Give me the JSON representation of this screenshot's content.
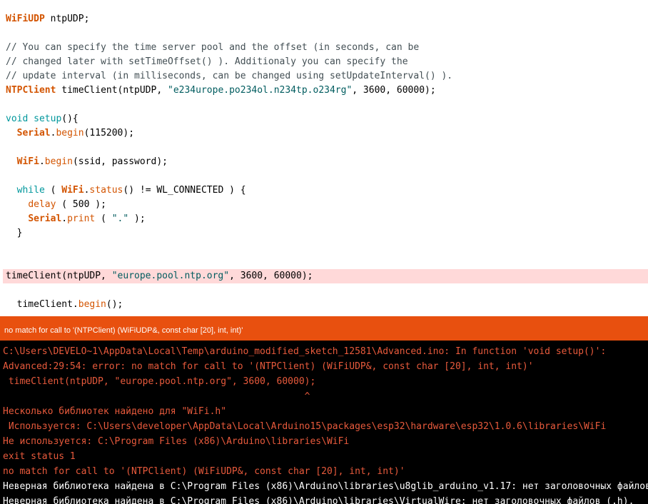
{
  "editor": {
    "lines": [
      [
        {
          "t": "WiFiUDP",
          "c": "type"
        },
        {
          "t": " ntpUDP;"
        }
      ],
      [],
      [
        {
          "t": "// You can specify the time server pool and the offset (in seconds, can be",
          "c": "cm"
        }
      ],
      [
        {
          "t": "// changed later with setTimeOffset() ). Additionaly you can specify the",
          "c": "cm"
        }
      ],
      [
        {
          "t": "// update interval (in milliseconds, can be changed using setUpdateInterval() ).",
          "c": "cm"
        }
      ],
      [
        {
          "t": "NTPClient",
          "c": "type"
        },
        {
          "t": " timeClient(ntpUDP, "
        },
        {
          "t": "\"e234urope.po234ol.n234tp.o234rg\"",
          "c": "str"
        },
        {
          "t": ", 3600, 60000);"
        }
      ],
      [],
      [
        {
          "t": "void",
          "c": "kw"
        },
        {
          "t": " "
        },
        {
          "t": "setup",
          "c": "kw"
        },
        {
          "t": "(){"
        }
      ],
      [
        {
          "t": "  "
        },
        {
          "t": "Serial",
          "c": "type"
        },
        {
          "t": "."
        },
        {
          "t": "begin",
          "c": "fn"
        },
        {
          "t": "(115200);"
        }
      ],
      [],
      [
        {
          "t": "  "
        },
        {
          "t": "WiFi",
          "c": "type"
        },
        {
          "t": "."
        },
        {
          "t": "begin",
          "c": "fn"
        },
        {
          "t": "(ssid, password);"
        }
      ],
      [],
      [
        {
          "t": "  "
        },
        {
          "t": "while",
          "c": "kw"
        },
        {
          "t": " ( "
        },
        {
          "t": "WiFi",
          "c": "type"
        },
        {
          "t": "."
        },
        {
          "t": "status",
          "c": "fn"
        },
        {
          "t": "() != WL_CONNECTED ) {"
        }
      ],
      [
        {
          "t": "    "
        },
        {
          "t": "delay",
          "c": "fn"
        },
        {
          "t": " ( 500 );"
        }
      ],
      [
        {
          "t": "    "
        },
        {
          "t": "Serial",
          "c": "type"
        },
        {
          "t": "."
        },
        {
          "t": "print",
          "c": "fn"
        },
        {
          "t": " ( "
        },
        {
          "t": "\".\"",
          "c": "str"
        },
        {
          "t": " );"
        }
      ],
      [
        {
          "t": "  }"
        }
      ],
      [],
      [],
      [
        {
          "t": "timeClient(ntpUDP, "
        },
        {
          "t": "\"europe.pool.ntp.org\"",
          "c": "str"
        },
        {
          "t": ", 3600, 60000);"
        }
      ],
      [],
      [
        {
          "t": "  timeClient."
        },
        {
          "t": "begin",
          "c": "fn"
        },
        {
          "t": "();"
        }
      ]
    ],
    "highlight_line": 18
  },
  "error_bar": {
    "message": "no match for call to '(NTPClient) (WiFiUDP&, const char [20], int, int)'"
  },
  "console": {
    "lines": [
      {
        "text": "C:\\Users\\DEVELO~1\\AppData\\Local\\Temp\\arduino_modified_sketch_12581\\Advanced.ino: In function 'void setup()':",
        "color": "red"
      },
      {
        "text": "Advanced:29:54: error: no match for call to '(NTPClient) (WiFiUDP&, const char [20], int, int)'",
        "color": "red"
      },
      {
        "text": " timeClient(ntpUDP, \"europe.pool.ntp.org\", 3600, 60000);",
        "color": "red"
      },
      {
        "text": "                                                      ^",
        "color": "red"
      },
      {
        "text": "Несколько библиотек найдено для \"WiFi.h\"",
        "color": "red"
      },
      {
        "text": " Используется: C:\\Users\\developer\\AppData\\Local\\Arduino15\\packages\\esp32\\hardware\\esp32\\1.0.6\\libraries\\WiFi",
        "color": "red"
      },
      {
        "text": "Не используется: C:\\Program Files (x86)\\Arduino\\libraries\\WiFi",
        "color": "red"
      },
      {
        "text": "exit status 1",
        "color": "red"
      },
      {
        "text": "no match for call to '(NTPClient) (WiFiUDP&, const char [20], int, int)'",
        "color": "red"
      },
      {
        "text": "Неверная библиотека найдена в C:\\Program Files (x86)\\Arduino\\libraries\\u8glib_arduino_v1.17: нет заголовочных файлов",
        "color": "white"
      },
      {
        "text": "Неверная библиотека найдена в C:\\Program Files (x86)\\Arduino\\libraries\\VirtualWire: нет заголовочных файлов (.h),",
        "color": "white"
      }
    ]
  }
}
